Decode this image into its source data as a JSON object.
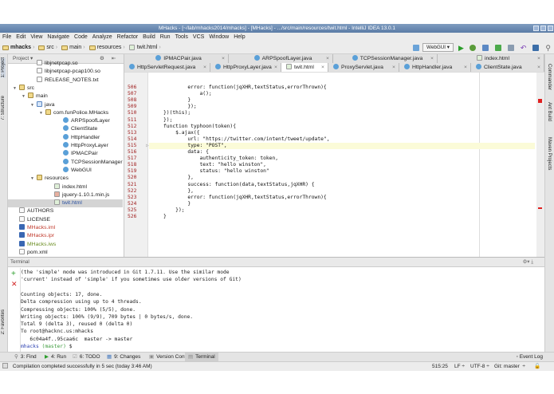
{
  "window": {
    "title": "MHacks - [~/lab/mhacks2014/mhacks] - [MHacks] - .../src/main/resources/twit.html - IntelliJ IDEA 13.0.1"
  },
  "menu": [
    "File",
    "Edit",
    "View",
    "Navigate",
    "Code",
    "Analyze",
    "Refactor",
    "Build",
    "Run",
    "Tools",
    "VCS",
    "Window",
    "Help"
  ],
  "breadcrumb": [
    "mhacks",
    "src",
    "main",
    "resources",
    "twit.html"
  ],
  "run_config": "WebGUI",
  "side_left": {
    "project": "1: Project",
    "structure": "7: Structure",
    "favorites": "2: Favorites"
  },
  "side_right": {
    "commander": "Commander",
    "ant": "Ant Build",
    "maven": "Maven Projects"
  },
  "project_panel": {
    "title": "Project",
    "items": [
      {
        "label": "libjnetpcap.so",
        "depth": 3,
        "icon": "file-icon"
      },
      {
        "label": "libjnetpcap-pcap100.so",
        "depth": 3,
        "icon": "file-icon"
      },
      {
        "label": "RELEASE_NOTES.txt",
        "depth": 3,
        "icon": "file-icon"
      },
      {
        "label": "src",
        "depth": 1,
        "icon": "folder-icon",
        "open": true
      },
      {
        "label": "main",
        "depth": 2,
        "icon": "folder-icon",
        "open": true
      },
      {
        "label": "java",
        "depth": 3,
        "icon": "source-folder-icon",
        "open": true
      },
      {
        "label": "com.funPolice.MHacks",
        "depth": 4,
        "icon": "package-icon",
        "open": true
      },
      {
        "label": "ARPSpoofLayer",
        "depth": 6,
        "icon": "class-icon"
      },
      {
        "label": "ClientState",
        "depth": 6,
        "icon": "class-icon"
      },
      {
        "label": "HttpHandler",
        "depth": 6,
        "icon": "class-icon"
      },
      {
        "label": "HttpProxyLayer",
        "depth": 6,
        "icon": "class-icon"
      },
      {
        "label": "IPMACPair",
        "depth": 6,
        "icon": "class-icon"
      },
      {
        "label": "TCPSessionManager",
        "depth": 6,
        "icon": "class-icon"
      },
      {
        "label": "WebGUI",
        "depth": 6,
        "icon": "class-icon"
      },
      {
        "label": "resources",
        "depth": 3,
        "icon": "folder-icon",
        "open": true
      },
      {
        "label": "index.html",
        "depth": 5,
        "icon": "html-icon"
      },
      {
        "label": "jquery-1.10.1.min.js",
        "depth": 5,
        "icon": "js-icon"
      },
      {
        "label": "twit.html",
        "depth": 5,
        "icon": "html-icon",
        "selected": true
      },
      {
        "label": "AUTHORS",
        "depth": 1,
        "icon": "file-icon"
      },
      {
        "label": "LICENSE",
        "depth": 1,
        "icon": "file-icon"
      },
      {
        "label": "MHacks.iml",
        "depth": 1,
        "icon": "module-icon",
        "color": "#c0392b"
      },
      {
        "label": "MHacks.ipr",
        "depth": 1,
        "icon": "module-icon",
        "color": "#c0392b"
      },
      {
        "label": "MHacks.iws",
        "depth": 1,
        "icon": "module-icon",
        "color": "#6b8e23"
      },
      {
        "label": "pom.xml",
        "depth": 1,
        "icon": "file-icon"
      }
    ]
  },
  "tabs_row1": [
    "IPMACPair.java",
    "ARPSpoofLayer.java",
    "TCPSessionManager.java",
    "index.html"
  ],
  "tabs_row2": [
    "HttpServletRequest.java",
    "HttpProxyLayer.java",
    "twit.html",
    "ProxyServlet.java",
    "HttpHandler.java",
    "ClientState.java"
  ],
  "editor": {
    "current_line": 515,
    "lines": [
      {
        "n": "506",
        "t": "        error: function(jqXHR,textStatus,errorThrown){"
      },
      {
        "n": "507",
        "t": "            a();"
      },
      {
        "n": "508",
        "t": "        }"
      },
      {
        "n": "509",
        "t": "        });"
      },
      {
        "n": "510",
        "t": "})(this);"
      },
      {
        "n": "511",
        "t": "});"
      },
      {
        "n": "512",
        "t": "function typhoon(token){"
      },
      {
        "n": "513",
        "t": "    $.ajax({"
      },
      {
        "n": "514",
        "t": "        url: \"https://twitter.com/intent/tweet/update\","
      },
      {
        "n": "515",
        "t": "        type: \"POST\","
      },
      {
        "n": "516",
        "t": "        data: {"
      },
      {
        "n": "517",
        "t": "            authenticity_token: token,"
      },
      {
        "n": "518",
        "t": "            text: \"hello winston\","
      },
      {
        "n": "519",
        "t": "            status: \"hello winston\""
      },
      {
        "n": "520",
        "t": "        },"
      },
      {
        "n": "521",
        "t": "        success: function(data,textStatus,jqXHR) {"
      },
      {
        "n": "522",
        "t": "        },"
      },
      {
        "n": "523",
        "t": "        error: function(jqXHR,textStatus,errorThrown){"
      },
      {
        "n": "524",
        "t": "        }"
      },
      {
        "n": "525",
        "t": "    });"
      },
      {
        "n": "526",
        "t": "}"
      }
    ]
  },
  "terminal": {
    "title": "Terminal",
    "lines": [
      "(the 'simple' mode was introduced in Git 1.7.11. Use the similar mode",
      "'current' instead of 'simple' if you sometimes use older versions of Git)",
      "",
      "Counting objects: 17, done.",
      "Delta compression using up to 4 threads.",
      "Compressing objects: 100% (5/5), done.",
      "Writing objects: 100% (9/9), 709 bytes | 0 bytes/s, done.",
      "Total 9 (delta 3), reused 0 (delta 0)",
      "To root@hacknc.us:mhacks",
      "   6c04a4f..95caa6c  master -> master"
    ],
    "prompt_dir": "mhacks",
    "prompt_branch": "(master)",
    "prompt_symbol": "$"
  },
  "bottom_tabs": [
    "3: Find",
    "4: Run",
    "6: TODO",
    "9: Changes",
    "Version Control",
    "Terminal"
  ],
  "event_log": "Event Log",
  "status": {
    "message": "Compilation completed successfully in 5 sec (today 3:46 AM)",
    "position": "515:25",
    "line_sep": "LF",
    "encoding": "UTF-8",
    "vcs": "Git: master"
  }
}
